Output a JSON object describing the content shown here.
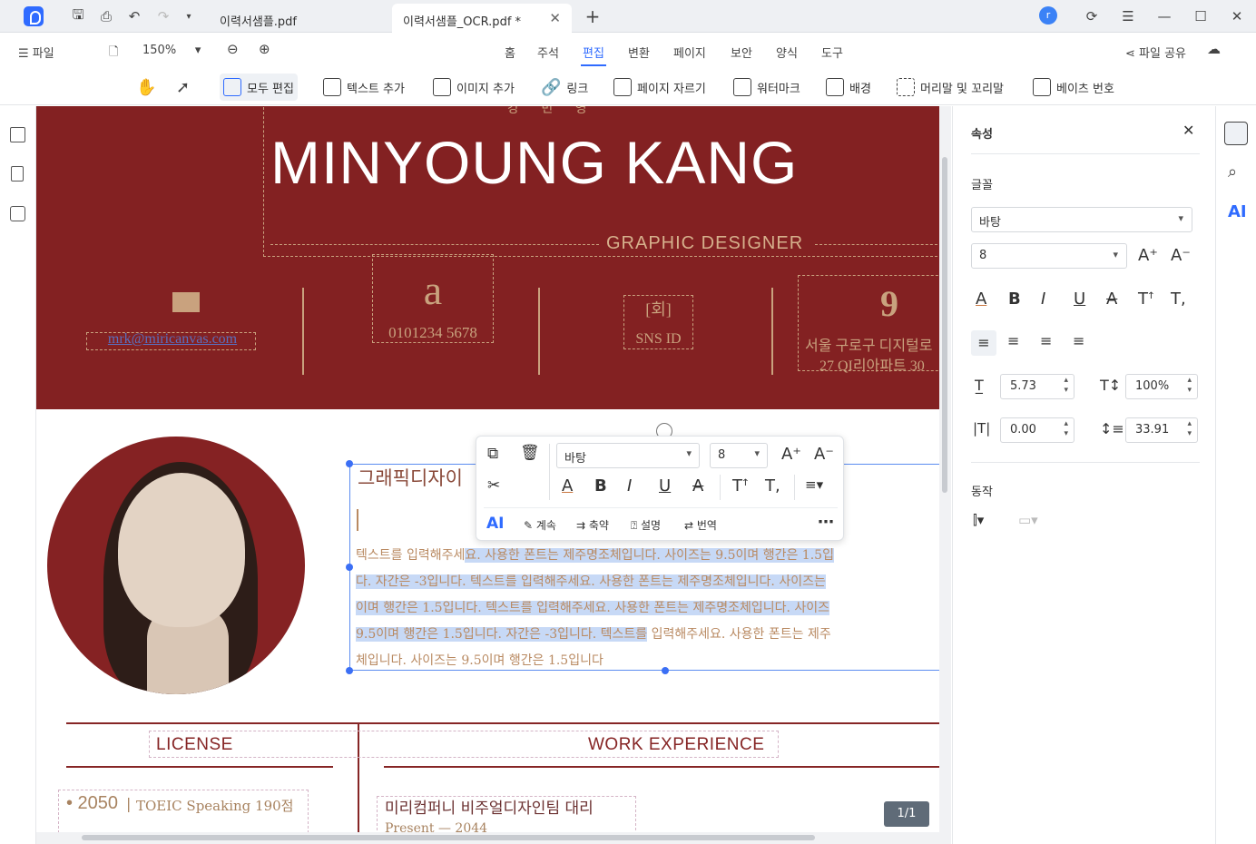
{
  "titlebar": {
    "tabs": [
      {
        "label": "이력서샘플.pdf"
      },
      {
        "label": "이력서샘플_OCR.pdf *"
      }
    ],
    "avatar_letter": "r"
  },
  "menubar": {
    "file_label": "파일",
    "zoom": "150%",
    "items": [
      "홈",
      "주석",
      "편집",
      "변환",
      "페이지",
      "보안",
      "양식",
      "도구"
    ],
    "active_item": "편집",
    "share_label": "파일 공유"
  },
  "toolbar": {
    "items": [
      "모두 편집",
      "텍스트 추가",
      "이미지 추가",
      "링크",
      "페이지 자르기",
      "워터마크",
      "배경",
      "머리말 및 꼬리말",
      "베이츠 번호"
    ]
  },
  "document": {
    "top_partial": "강 민 영",
    "name": "MINYOUNG KANG",
    "role": "GRAPHIC DESIGNER",
    "email": "mrk@miricanvas.com",
    "phone_glyph": "a",
    "phone": "0101234 5678",
    "sns_glyph": "[회]",
    "sns": "SNS ID",
    "address_glyph": "9",
    "address_line1": "서울 구로구 디지털로",
    "address_line2": "27 QI리아파트 30",
    "heading": "그래픽디자이",
    "body_lines": [
      {
        "plain": "텍스트를 입력해주세",
        "hl": "요. 사용한 폰트는 제주명조체입니다. 사이즈는 9.5이며 행간은 1.5입",
        "after": ""
      },
      {
        "plain": "",
        "hl": "다. 자간은 -3입니다. 텍스트를 입력해주세요. 사용한 폰트는 제주명조체입니다. 사이즈는",
        "after": ""
      },
      {
        "plain": "",
        "hl": "이며 행간은 1.5입니다. 텍스트를 입력해주세요. 사용한 폰트는 제주명조체입니다. 사이즈",
        "after": ""
      },
      {
        "plain": "",
        "hl": "9.5이며 행간은 1.5입니다. 자간은 -3입니다. 텍스트를",
        "after": " 입력해주세요. 사용한 폰트는 제주"
      },
      {
        "plain": "체입니다. 사이즈는 9.5이며 행간은 1.5입니다",
        "hl": "",
        "after": ""
      }
    ],
    "license_title": "LICENSE",
    "work_title": "WORK EXPERIENCE",
    "license_year": "• 2050",
    "license_item": "TOEIC Speaking 190점",
    "work_item": "미리컴퍼니 비주얼디자인팀 대리",
    "work_period": "Present — 2044"
  },
  "float_toolbar": {
    "font": "바탕",
    "size": "8",
    "ai_actions": [
      "계속",
      "축약",
      "설명",
      "번역"
    ]
  },
  "page_indicator": "1/1",
  "properties": {
    "title": "속성",
    "font_section": "글꼴",
    "font": "바탕",
    "size": "8",
    "line_height": "5.73",
    "scale": "100%",
    "char_spacing": "0.00",
    "spacing2": "33.91",
    "action_section": "동작"
  },
  "colors": {
    "accent": "#2f6bff",
    "banner": "#832122",
    "gold": "#c9a27e"
  }
}
